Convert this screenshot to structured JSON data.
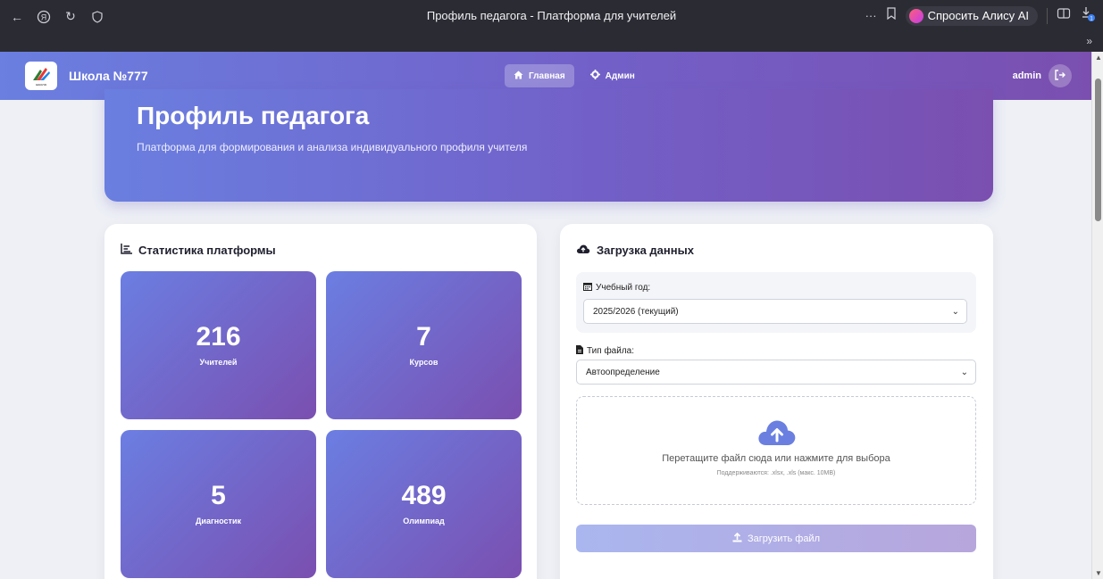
{
  "browser": {
    "title": "Профиль педагога - Платформа для учителей",
    "alisa_label": "Спросить Алису AI",
    "menu_dots": "···",
    "chevron": "»"
  },
  "nav": {
    "brand": "Школа №777",
    "logo_text": "школа",
    "links": [
      {
        "label": "Главная",
        "icon": "home-icon",
        "active": true
      },
      {
        "label": "Админ",
        "icon": "cog-icon",
        "active": false
      }
    ],
    "user": "admin"
  },
  "hero": {
    "title": "Профиль педагога",
    "subtitle": "Платформа для формирования и анализа индивидуального профиля учителя"
  },
  "stats": {
    "title": "Статистика платформы",
    "items": [
      {
        "value": "216",
        "label": "Учителей"
      },
      {
        "value": "7",
        "label": "Курсов"
      },
      {
        "value": "5",
        "label": "Диагностик"
      },
      {
        "value": "489",
        "label": "Олимпиад"
      }
    ]
  },
  "upload": {
    "title": "Загрузка данных",
    "year_label": "Учебный год:",
    "year_value": "2025/2026 (текущий)",
    "type_label": "Тип файла:",
    "type_value": "Автоопределение",
    "drop_text": "Перетащите файл сюда или нажмите для выбора",
    "drop_sub": "Поддерживаются: .xlsx, .xls (макс. 10MB)",
    "button": "Загрузить файл"
  },
  "colors": {
    "gradient_start": "#6a7fe0",
    "gradient_end": "#7a4fb0",
    "cloud": "#6a7fe0"
  }
}
